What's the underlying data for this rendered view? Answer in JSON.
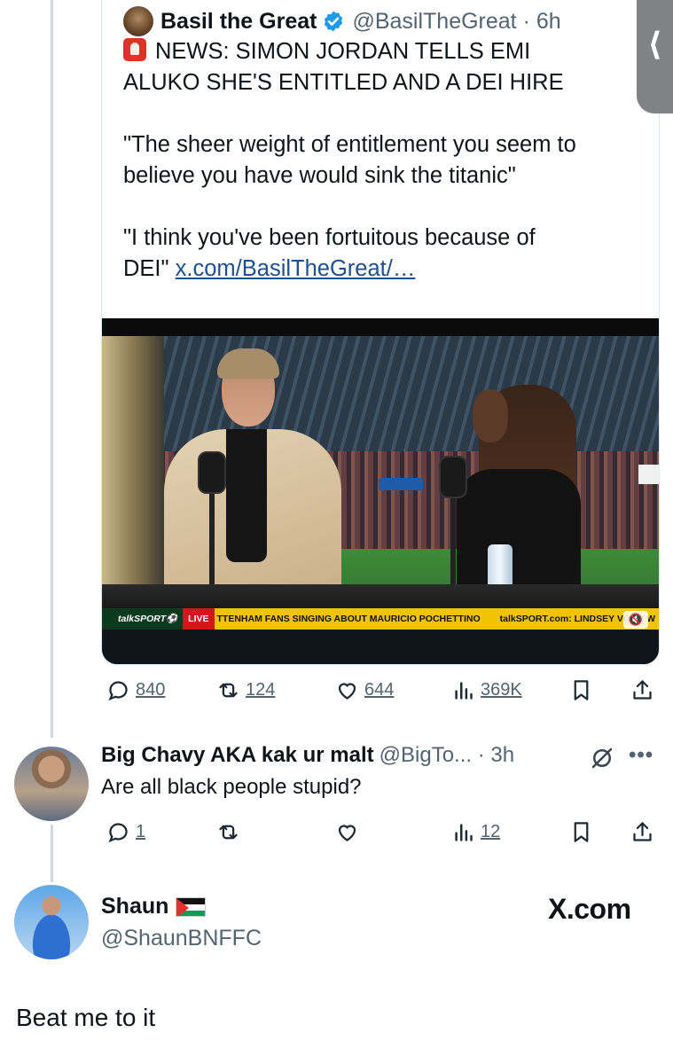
{
  "quoted_tweet": {
    "author_name": "Basil the Great",
    "handle_time": "@BasilTheGreat · 6h",
    "headline_line1": "NEWS: SIMON JORDAN TELLS EMI",
    "headline_line2": "ALUKO SHE'S ENTITLED AND A DEI HIRE",
    "quote1_line1": "\"The sheer weight of entitlement you seem to",
    "quote1_line2": "believe you have would sink the titanic\"",
    "quote2_line1": "\"I think you've been fortuitous because of",
    "quote2_prefix": "DEI\" ",
    "link": "x.com/BasilTheGreat/…",
    "video": {
      "channel": "talkSPORT⚽",
      "live_label": "LIVE",
      "ticker_headline": "TTENHAM FANS SINGING ABOUT MAURICIO POCHETTINO",
      "ticker_site": "talkSPORT.com: LINDSEY VONN W"
    },
    "stats": {
      "replies": "840",
      "reposts": "124",
      "likes": "644",
      "views": "369K"
    }
  },
  "reply": {
    "author_name": "Big Chavy AKA kak ur malt",
    "handle_time": "@BigTo... · 3h",
    "text": "Are all black people stupid?",
    "stats": {
      "replies": "1",
      "views": "12"
    }
  },
  "poster": {
    "name": "Shaun",
    "handle": "@ShaunBNFFC",
    "watermark": "X.com",
    "text": "Beat me to it"
  },
  "side_tab": {
    "glyph": "⟨"
  },
  "colors": {
    "verified": "#1d9bf0",
    "secondary_text": "#536471",
    "link": "#1d4f91",
    "ticker_yellow": "#f2c400"
  }
}
